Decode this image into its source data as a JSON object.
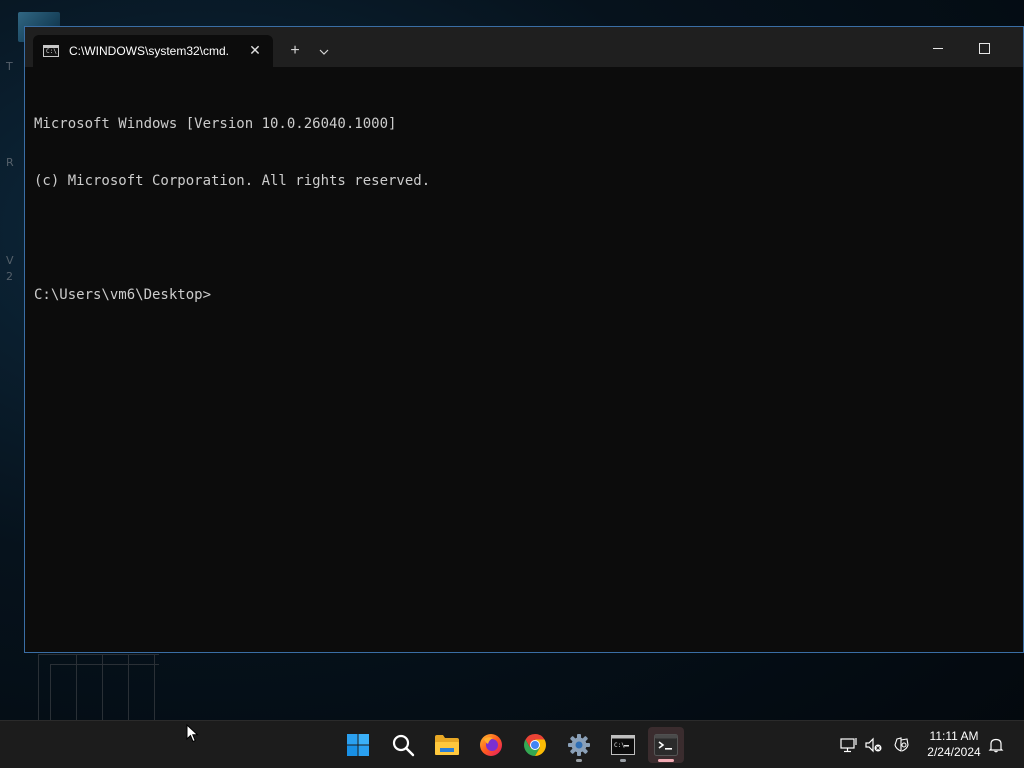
{
  "desktop": {
    "side_letters": [
      "T",
      "R",
      "V",
      "2"
    ]
  },
  "window": {
    "tab_title": "C:\\WINDOWS\\system32\\cmd.",
    "tab_icon_text": "C:\\",
    "new_tab_symbol": "+",
    "dropdown_symbol": "⌄",
    "close_tab_symbol": "✕"
  },
  "console": {
    "lines": [
      "Microsoft Windows [Version 10.0.26040.1000]",
      "(c) Microsoft Corporation. All rights reserved.",
      "",
      "C:\\Users\\vm6\\Desktop>"
    ]
  },
  "taskbar": {
    "items": [
      {
        "name": "start-button",
        "icon": "windows-logo-icon"
      },
      {
        "name": "search-button",
        "icon": "search-icon"
      },
      {
        "name": "file-explorer-button",
        "icon": "folder-icon"
      },
      {
        "name": "firefox-button",
        "icon": "firefox-icon"
      },
      {
        "name": "chrome-button",
        "icon": "chrome-icon"
      },
      {
        "name": "settings-button",
        "icon": "gear-icon"
      },
      {
        "name": "command-prompt-button",
        "icon": "cmd-icon"
      },
      {
        "name": "terminal-button",
        "icon": "terminal-icon"
      }
    ],
    "tray": {
      "time": "11:11 AM",
      "date": "2/24/2024"
    }
  },
  "colors": {
    "window_border": "#3a6ea5",
    "console_bg": "#0c0c0c",
    "console_text": "#cccccc",
    "taskbar_bg": "#1c1c1c",
    "active_indicator": "#f2aab3"
  }
}
